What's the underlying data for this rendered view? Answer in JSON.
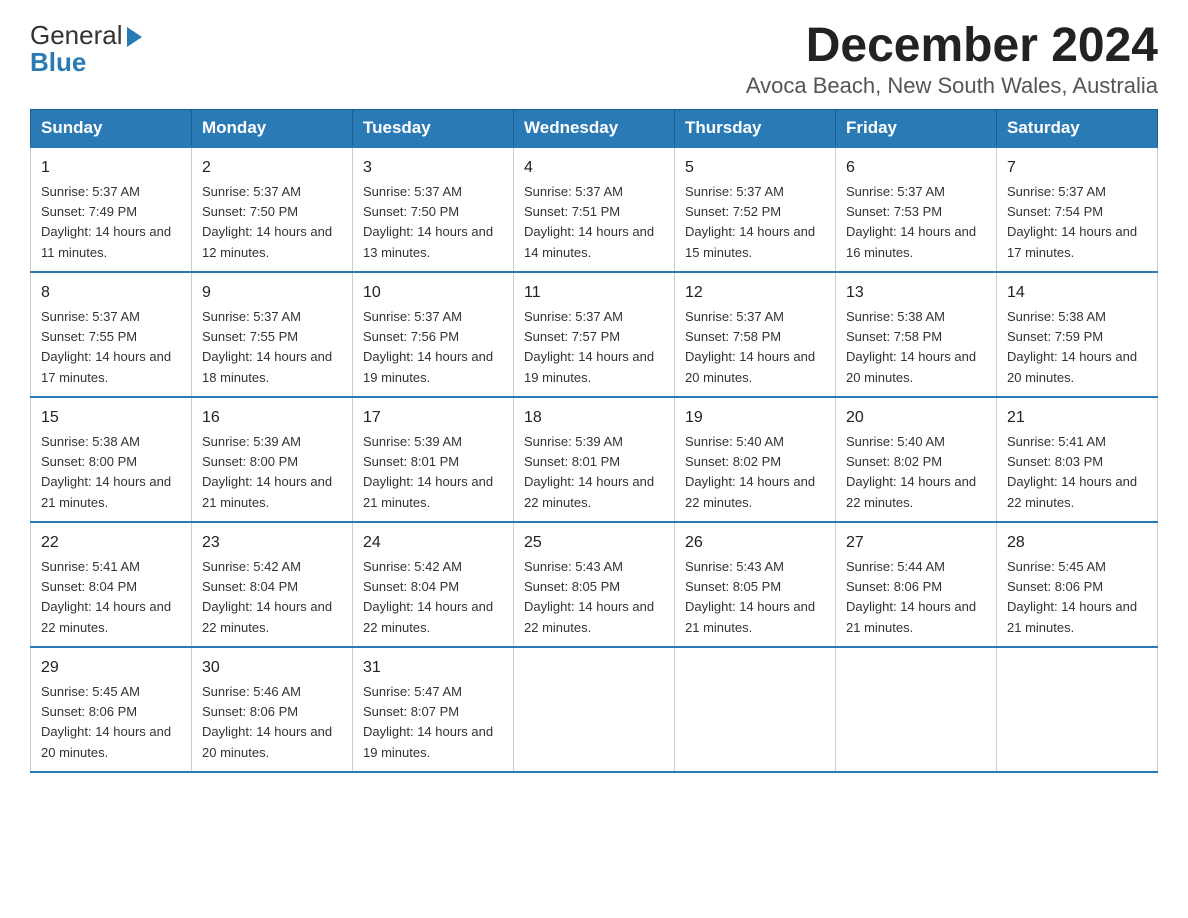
{
  "header": {
    "logo_line1": "General",
    "logo_line2": "Blue",
    "title": "December 2024",
    "subtitle": "Avoca Beach, New South Wales, Australia"
  },
  "columns": [
    "Sunday",
    "Monday",
    "Tuesday",
    "Wednesday",
    "Thursday",
    "Friday",
    "Saturday"
  ],
  "weeks": [
    [
      {
        "day": "1",
        "sunrise": "5:37 AM",
        "sunset": "7:49 PM",
        "daylight": "14 hours and 11 minutes."
      },
      {
        "day": "2",
        "sunrise": "5:37 AM",
        "sunset": "7:50 PM",
        "daylight": "14 hours and 12 minutes."
      },
      {
        "day": "3",
        "sunrise": "5:37 AM",
        "sunset": "7:50 PM",
        "daylight": "14 hours and 13 minutes."
      },
      {
        "day": "4",
        "sunrise": "5:37 AM",
        "sunset": "7:51 PM",
        "daylight": "14 hours and 14 minutes."
      },
      {
        "day": "5",
        "sunrise": "5:37 AM",
        "sunset": "7:52 PM",
        "daylight": "14 hours and 15 minutes."
      },
      {
        "day": "6",
        "sunrise": "5:37 AM",
        "sunset": "7:53 PM",
        "daylight": "14 hours and 16 minutes."
      },
      {
        "day": "7",
        "sunrise": "5:37 AM",
        "sunset": "7:54 PM",
        "daylight": "14 hours and 17 minutes."
      }
    ],
    [
      {
        "day": "8",
        "sunrise": "5:37 AM",
        "sunset": "7:55 PM",
        "daylight": "14 hours and 17 minutes."
      },
      {
        "day": "9",
        "sunrise": "5:37 AM",
        "sunset": "7:55 PM",
        "daylight": "14 hours and 18 minutes."
      },
      {
        "day": "10",
        "sunrise": "5:37 AM",
        "sunset": "7:56 PM",
        "daylight": "14 hours and 19 minutes."
      },
      {
        "day": "11",
        "sunrise": "5:37 AM",
        "sunset": "7:57 PM",
        "daylight": "14 hours and 19 minutes."
      },
      {
        "day": "12",
        "sunrise": "5:37 AM",
        "sunset": "7:58 PM",
        "daylight": "14 hours and 20 minutes."
      },
      {
        "day": "13",
        "sunrise": "5:38 AM",
        "sunset": "7:58 PM",
        "daylight": "14 hours and 20 minutes."
      },
      {
        "day": "14",
        "sunrise": "5:38 AM",
        "sunset": "7:59 PM",
        "daylight": "14 hours and 20 minutes."
      }
    ],
    [
      {
        "day": "15",
        "sunrise": "5:38 AM",
        "sunset": "8:00 PM",
        "daylight": "14 hours and 21 minutes."
      },
      {
        "day": "16",
        "sunrise": "5:39 AM",
        "sunset": "8:00 PM",
        "daylight": "14 hours and 21 minutes."
      },
      {
        "day": "17",
        "sunrise": "5:39 AM",
        "sunset": "8:01 PM",
        "daylight": "14 hours and 21 minutes."
      },
      {
        "day": "18",
        "sunrise": "5:39 AM",
        "sunset": "8:01 PM",
        "daylight": "14 hours and 22 minutes."
      },
      {
        "day": "19",
        "sunrise": "5:40 AM",
        "sunset": "8:02 PM",
        "daylight": "14 hours and 22 minutes."
      },
      {
        "day": "20",
        "sunrise": "5:40 AM",
        "sunset": "8:02 PM",
        "daylight": "14 hours and 22 minutes."
      },
      {
        "day": "21",
        "sunrise": "5:41 AM",
        "sunset": "8:03 PM",
        "daylight": "14 hours and 22 minutes."
      }
    ],
    [
      {
        "day": "22",
        "sunrise": "5:41 AM",
        "sunset": "8:04 PM",
        "daylight": "14 hours and 22 minutes."
      },
      {
        "day": "23",
        "sunrise": "5:42 AM",
        "sunset": "8:04 PM",
        "daylight": "14 hours and 22 minutes."
      },
      {
        "day": "24",
        "sunrise": "5:42 AM",
        "sunset": "8:04 PM",
        "daylight": "14 hours and 22 minutes."
      },
      {
        "day": "25",
        "sunrise": "5:43 AM",
        "sunset": "8:05 PM",
        "daylight": "14 hours and 22 minutes."
      },
      {
        "day": "26",
        "sunrise": "5:43 AM",
        "sunset": "8:05 PM",
        "daylight": "14 hours and 21 minutes."
      },
      {
        "day": "27",
        "sunrise": "5:44 AM",
        "sunset": "8:06 PM",
        "daylight": "14 hours and 21 minutes."
      },
      {
        "day": "28",
        "sunrise": "5:45 AM",
        "sunset": "8:06 PM",
        "daylight": "14 hours and 21 minutes."
      }
    ],
    [
      {
        "day": "29",
        "sunrise": "5:45 AM",
        "sunset": "8:06 PM",
        "daylight": "14 hours and 20 minutes."
      },
      {
        "day": "30",
        "sunrise": "5:46 AM",
        "sunset": "8:06 PM",
        "daylight": "14 hours and 20 minutes."
      },
      {
        "day": "31",
        "sunrise": "5:47 AM",
        "sunset": "8:07 PM",
        "daylight": "14 hours and 19 minutes."
      },
      null,
      null,
      null,
      null
    ]
  ]
}
